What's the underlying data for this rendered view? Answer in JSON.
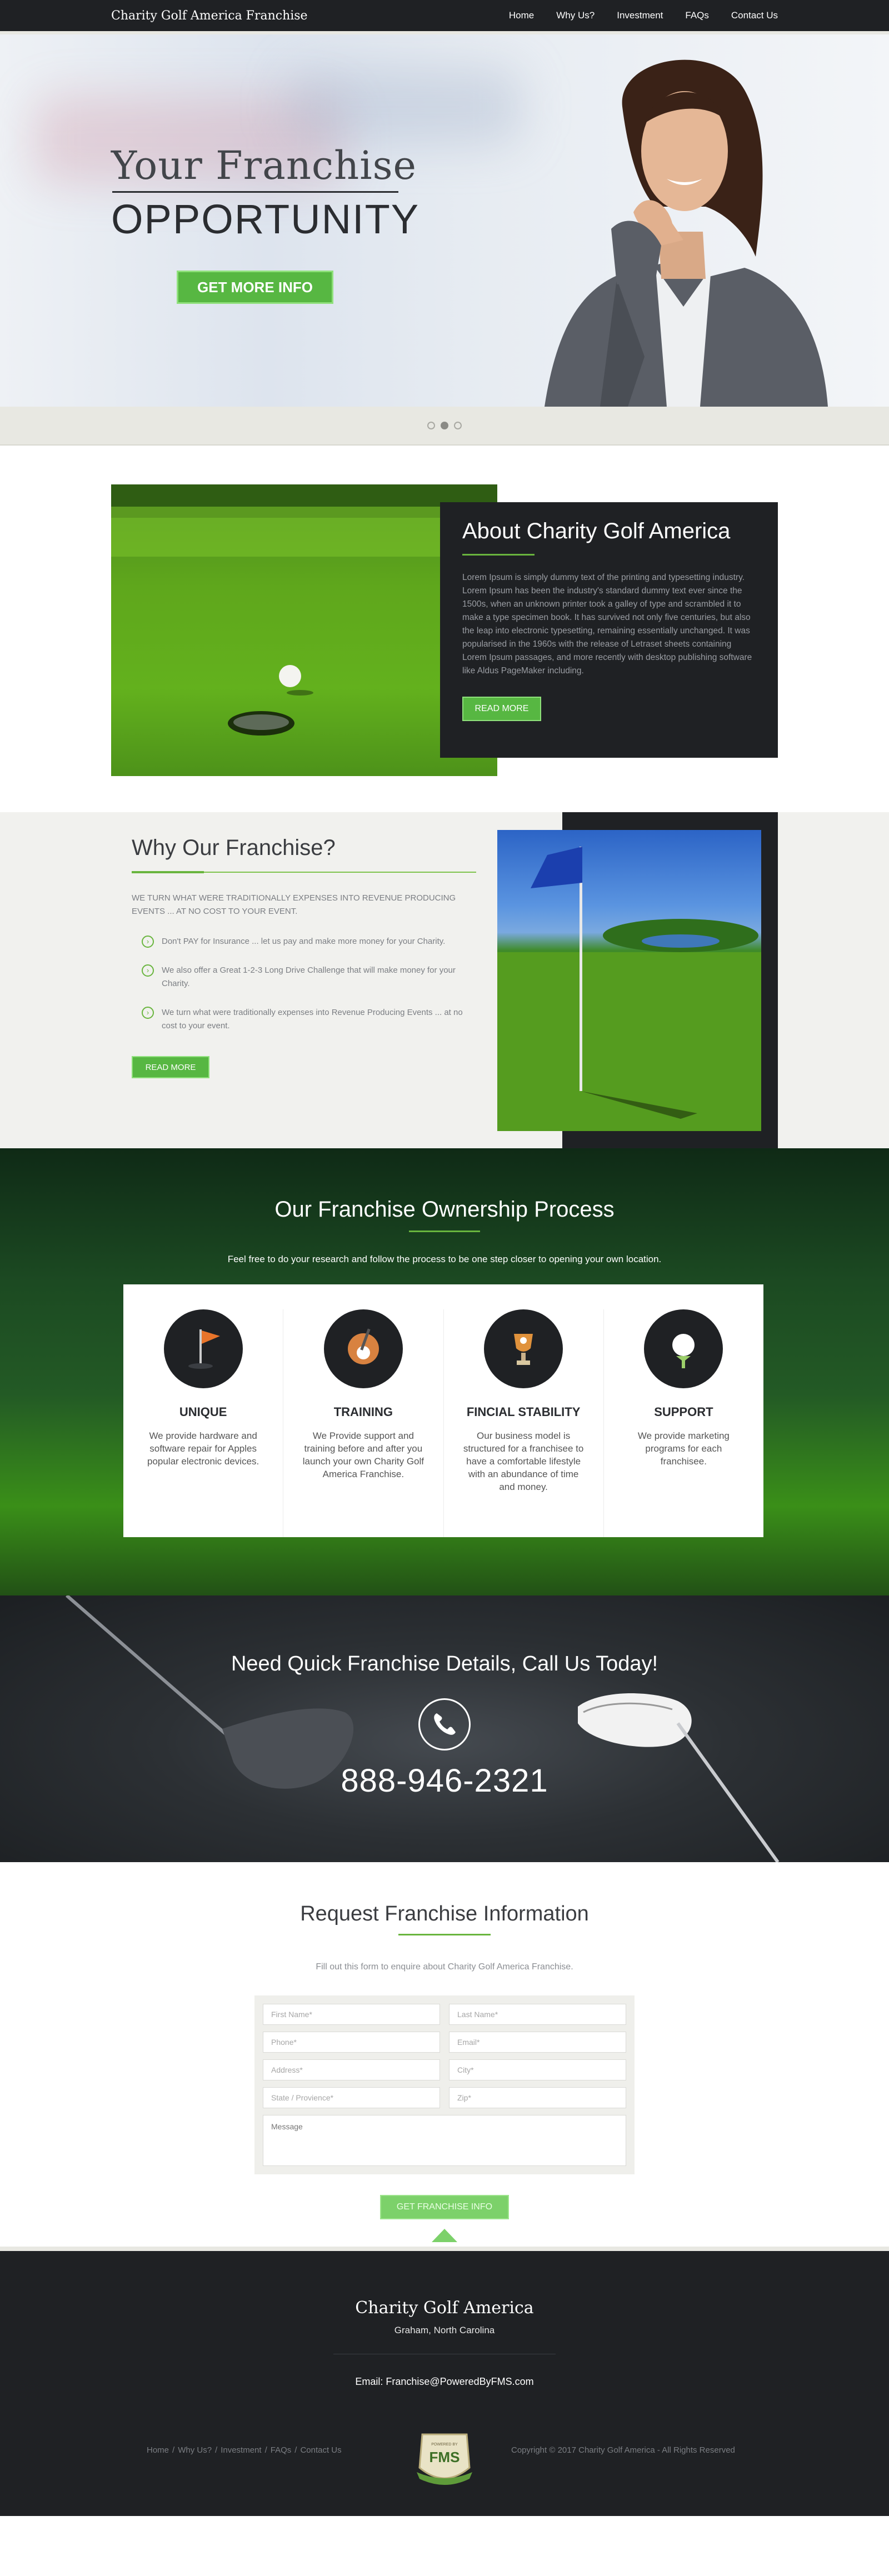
{
  "nav": {
    "brand": "Charity Golf America Franchise",
    "items": [
      "Home",
      "Why Us?",
      "Investment",
      "FAQs",
      "Contact Us"
    ]
  },
  "hero": {
    "title_line1": "Your Franchise",
    "title_line2": "OPPORTUNITY",
    "cta": "GET MORE INFO",
    "slides_active": 2
  },
  "about": {
    "heading": "About Charity Golf America",
    "body": "Lorem Ipsum is simply dummy text of the printing and typesetting industry. Lorem Ipsum has been the industry's standard dummy text ever since the 1500s, when an unknown printer took a galley of type and scrambled it to make a type specimen book. It has survived not only five centuries, but also the leap into electronic typesetting, remaining essentially unchanged. It was popularised in the 1960s with the release of Letraset sheets containing Lorem Ipsum passages, and more recently with desktop publishing software like Aldus PageMaker including.",
    "button": "READ MORE"
  },
  "why": {
    "heading": "Why Our Franchise?",
    "subheading": "WE TURN WHAT WERE TRADITIONALLY EXPENSES INTO REVENUE PRODUCING EVENTS ... AT NO COST TO YOUR EVENT.",
    "points": [
      "Don't PAY for Insurance ... let us pay and make more money for your Charity.",
      "We also offer a Great 1-2-3 Long Drive Challenge that will make money for your Charity.",
      "We turn what were traditionally expenses into Revenue Producing Events ... at no cost to your event."
    ],
    "button": "READ MORE"
  },
  "process": {
    "heading": "Our Franchise Ownership Process",
    "subheading": "Feel free to do your research and follow the process to be one step closer to opening your own location.",
    "items": [
      {
        "title": "UNIQUE",
        "text": "We provide hardware and software repair for Apples popular electronic devices."
      },
      {
        "title": "TRAINING",
        "text": "We Provide support and training before and after you launch your own Charity Golf America Franchise."
      },
      {
        "title": "FINCIAL STABILITY",
        "text": "Our business model is structured for a franchisee to have a comfortable lifestyle with an abundance of time and money."
      },
      {
        "title": "SUPPORT",
        "text": "We provide marketing programs for each franchisee."
      }
    ]
  },
  "call": {
    "heading": "Need Quick Franchise Details, Call Us Today!",
    "phone": "888-946-2321"
  },
  "form": {
    "heading": "Request Franchise Information",
    "subheading": "Fill out this form to enquire about Charity Golf America Franchise.",
    "placeholders": {
      "first_name": "First Name*",
      "last_name": "Last Name*",
      "phone": "Phone*",
      "email": "Email*",
      "address": "Address*",
      "city": "City*",
      "state": "State / Provience*",
      "zip": "Zip*",
      "message": "Message"
    },
    "button": "GET FRANCHISE INFO"
  },
  "footer": {
    "name": "Charity Golf America",
    "location": "Graham, North Carolina",
    "email": "Email: Franchise@PoweredByFMS.com",
    "links": [
      "Home",
      "Why Us?",
      "Investment",
      "FAQs",
      "Contact Us"
    ],
    "separator": "/",
    "badge_text": "FMS",
    "badge_top": "POWERED BY",
    "copyright": "Copyright © 2017 Charity Golf America - All Rights Reserved"
  },
  "colors": {
    "dark": "#1f2124",
    "accent_green": "#57b742",
    "icon_bg": "#1f2124"
  }
}
